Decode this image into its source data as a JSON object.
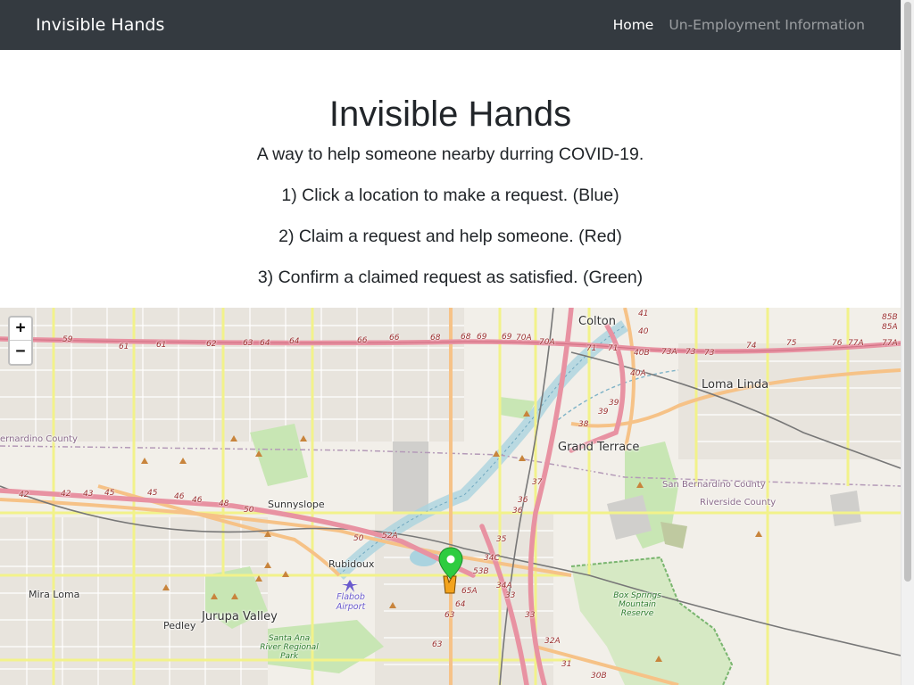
{
  "navbar": {
    "brand": "Invisible Hands",
    "links": [
      {
        "label": "Home",
        "active": true
      },
      {
        "label": "Un-Employment Information",
        "active": false
      }
    ]
  },
  "hero": {
    "title": "Invisible Hands",
    "subtitle": "A way to help someone nearby durring COVID-19.",
    "steps": [
      "1) Click a location to make a request. (Blue)",
      "2) Claim a request and help someone. (Red)",
      "3) Confirm a claimed request as satisfied. (Green)"
    ]
  },
  "map": {
    "zoom_in": "+",
    "zoom_out": "−",
    "places": [
      "Colton",
      "Loma Linda",
      "Grand Terrace",
      "Sunnyslope",
      "Rubidoux",
      "Mira Loma",
      "Jurupa Valley",
      "Pedley"
    ],
    "county_labels": [
      "San Bernardino County",
      "Riverside County",
      "ernardino County"
    ],
    "park_labels": [
      "Box Springs Mountain Reserve",
      "Santa Ana River Regional Park"
    ],
    "airport_label": "Flabob Airport",
    "exit_numbers": [
      "59",
      "61",
      "61",
      "62",
      "63",
      "64",
      "64",
      "66",
      "66",
      "68",
      "68",
      "69",
      "69",
      "70A",
      "70A",
      "71",
      "71",
      "73A",
      "73",
      "73",
      "74",
      "75",
      "76",
      "77A",
      "77A",
      "85B",
      "85A",
      "41",
      "40",
      "40B",
      "40A",
      "39",
      "39",
      "38",
      "37",
      "36",
      "36",
      "35",
      "34C",
      "53B",
      "34A",
      "33",
      "33",
      "65A",
      "64",
      "63",
      "63",
      "32A",
      "31",
      "30B",
      "42",
      "42",
      "43",
      "45",
      "45",
      "46",
      "46",
      "48",
      "50",
      "50",
      "52A"
    ],
    "markers": [
      {
        "color": "green",
        "meaning": "satisfied request"
      },
      {
        "color": "orange",
        "meaning": "figure"
      }
    ],
    "colors": {
      "land": "#f2efe9",
      "motorway": "#e892a2",
      "primary": "#fcd6a4",
      "secondary": "#f7fabf",
      "park": "#c8e6b4",
      "water": "#aad3df",
      "rail": "#666666"
    }
  }
}
